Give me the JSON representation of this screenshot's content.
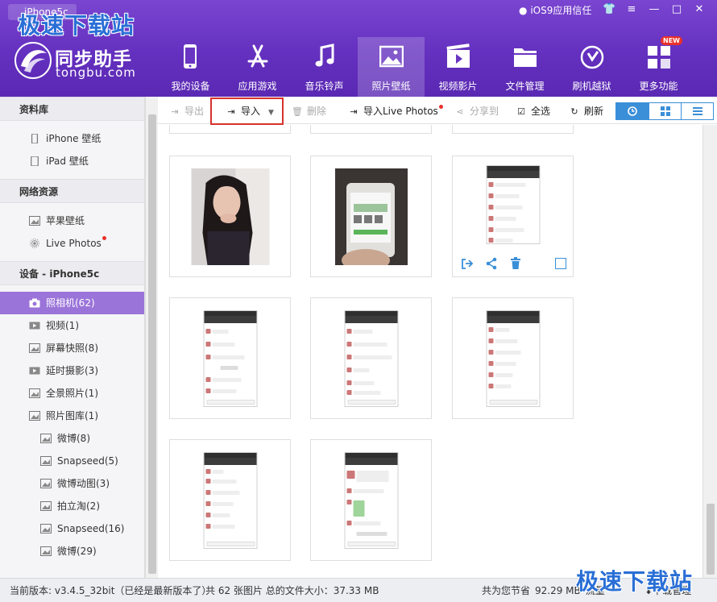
{
  "device_tab": "iPhone5c",
  "watermark": "极速下载站",
  "brand": {
    "name": "同步助手",
    "sub": "tongbu.com"
  },
  "ios_trust": "iOS9应用信任",
  "window_buttons": {
    "shirt": "👕",
    "menu": "≡",
    "minimize": "—",
    "maximize": "□",
    "close": "✕"
  },
  "nav": [
    {
      "label": "我的设备",
      "icon": "phone-icon"
    },
    {
      "label": "应用游戏",
      "icon": "app-store-icon"
    },
    {
      "label": "音乐铃声",
      "icon": "music-icon"
    },
    {
      "label": "照片壁纸",
      "icon": "photo-icon",
      "active": true
    },
    {
      "label": "视频影片",
      "icon": "video-icon"
    },
    {
      "label": "文件管理",
      "icon": "folder-icon"
    },
    {
      "label": "刷机越狱",
      "icon": "flash-icon"
    },
    {
      "label": "更多功能",
      "icon": "more-icon",
      "badge": "NEW"
    }
  ],
  "sidebar": {
    "library_header": "资料库",
    "library": [
      "iPhone 壁纸",
      "iPad 壁纸"
    ],
    "web_header": "网络资源",
    "web": [
      "苹果壁纸",
      "Live Photos"
    ],
    "device_header": "设备 - iPhone5c",
    "device": [
      {
        "label": "照相机(62)",
        "icon": "camera-icon",
        "active": true
      },
      {
        "label": "视频(1)",
        "icon": "video-icon"
      },
      {
        "label": "屏幕快照(8)",
        "icon": "image-icon"
      },
      {
        "label": "延时摄影(3)",
        "icon": "video-icon"
      },
      {
        "label": "全景照片(1)",
        "icon": "image-icon"
      },
      {
        "label": "照片图库(1)",
        "icon": "image-icon"
      }
    ],
    "albums": [
      "微博(8)",
      "Snapseed(5)",
      "微博动图(3)",
      "拍立淘(2)",
      "Snapseed(16)",
      "微博(29)"
    ]
  },
  "toolbar": {
    "export": "导出",
    "import": "导入",
    "delete": "删除",
    "import_live": "导入Live Photos",
    "share": "分享到",
    "select_all": "全选",
    "refresh": "刷新"
  },
  "status": {
    "version": "当前版本: v3.4.5_32bit（已经是最新版本了）",
    "count": "共 62 张图片 总的文件大小：37.33 MB",
    "save_prefix": "共为您节省",
    "save_value": "92.29 MB",
    "save_suffix": "流量",
    "download_mgr": "下载管理"
  }
}
